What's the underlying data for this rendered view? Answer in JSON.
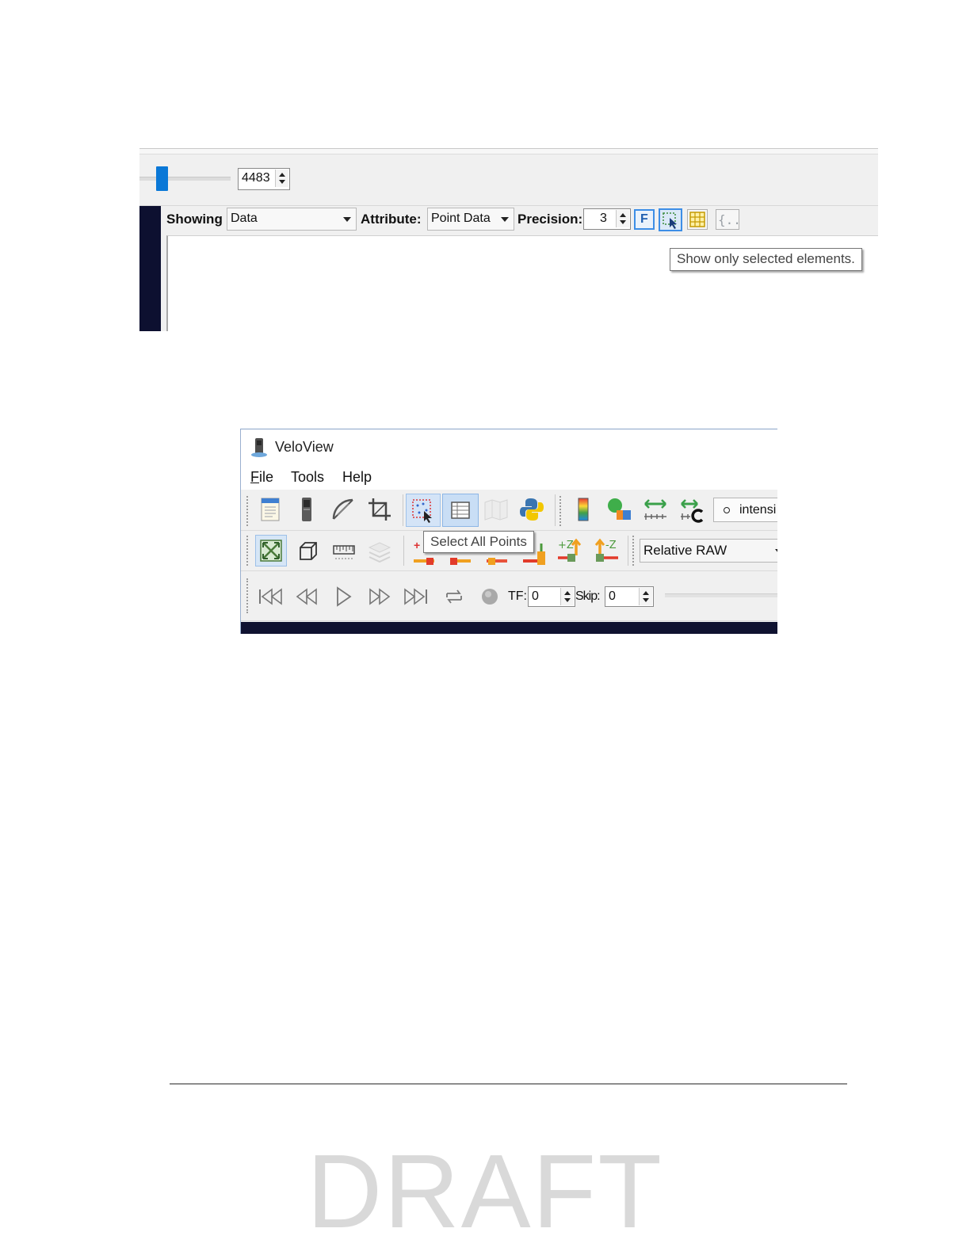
{
  "spreadsheet": {
    "frame_value": "4483",
    "showing_label": "Showing",
    "showing_value": "Data",
    "attribute_label": "Attribute:",
    "attribute_value": "Point Data",
    "precision_label": "Precision:",
    "precision_value": "3",
    "fixed_button_label": "F",
    "tooltip": "Show only selected elements.",
    "slider_fraction": 0.05,
    "icons": [
      "f-fixed-icon",
      "show-selected-icon",
      "column-visibility-icon",
      "toggle-cell-icon"
    ]
  },
  "veloview": {
    "title": "VeloView",
    "menu": [
      {
        "label": "File",
        "underline_index": 0
      },
      {
        "label": "Tools"
      },
      {
        "label": "Help"
      }
    ],
    "toolbar1": {
      "icons": [
        "open-file-icon",
        "sensor-stream-icon",
        "measure-protractor-icon",
        "crop-icon",
        "select-points-icon",
        "spreadsheet-icon",
        "map-icon",
        "python-shell-icon",
        "color-legend-icon",
        "color-by-icon",
        "distance-ruler-icon",
        "arc-measure-icon"
      ],
      "array_selector": "intensi"
    },
    "toolbar2": {
      "icons": [
        "reset-camera-icon",
        "cube-view-icon",
        "ruler-grid-icon",
        "layers-icon",
        "plus-x-icon",
        "minus-x-icon",
        "plus-y-icon",
        "minus-y-icon",
        "plus-z-icon",
        "minus-z-icon"
      ],
      "plus_z_label": "+Z",
      "minus_z_label": "-Z",
      "plus_x_label": "+",
      "mode_value": "Relative RAW",
      "tooltip": "Select All Points"
    },
    "toolbar3": {
      "icons": [
        "first-frame-icon",
        "previous-frame-icon",
        "play-icon",
        "next-frame-icon",
        "last-frame-icon",
        "loop-icon",
        "record-icon"
      ],
      "tf_label": "TF:",
      "tf_value": "0",
      "skip_label": "Skip:",
      "skip_value": "0"
    }
  },
  "watermark": "DRAFT"
}
